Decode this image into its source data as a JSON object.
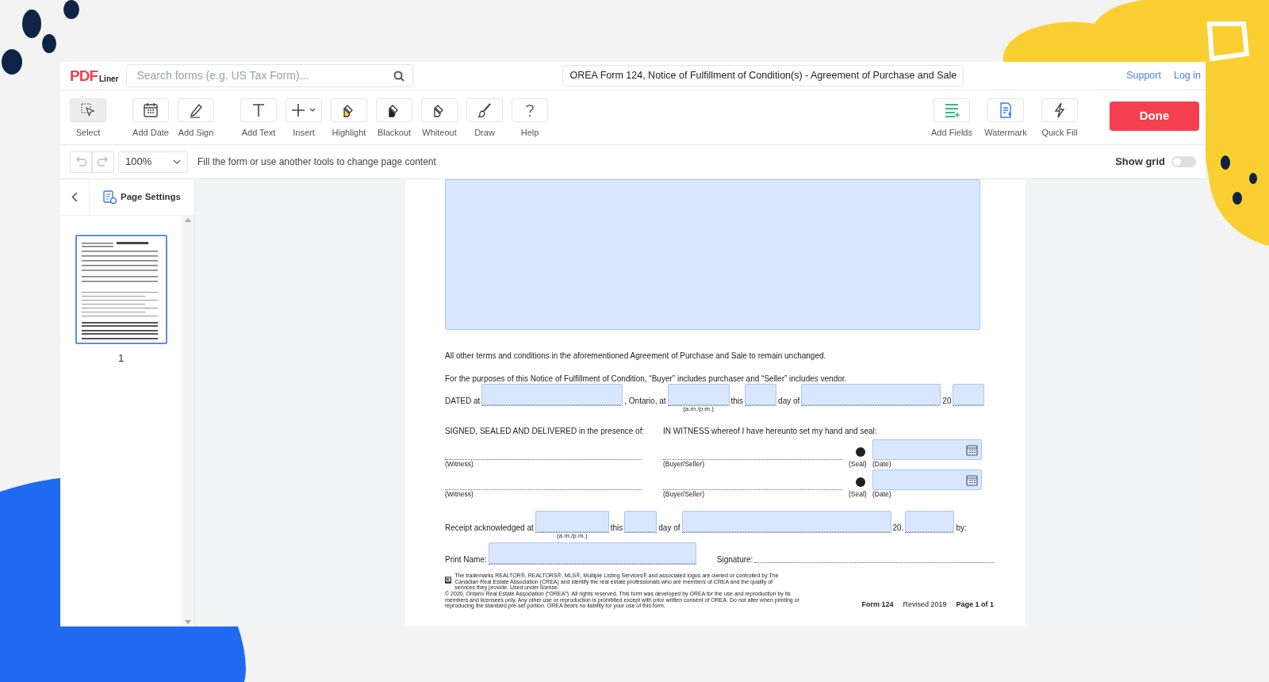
{
  "logo": {
    "mark": "PDF",
    "word": "Liner"
  },
  "search": {
    "placeholder": "Search forms (e.g. US Tax Form)..."
  },
  "document_title": "OREA Form 124, Notice of Fulfillment of Condition(s) - Agreement of Purchase and Sale",
  "header_links": [
    "Support",
    "Log in"
  ],
  "tool_groups": [
    [
      {
        "label": "Select",
        "selected": true
      }
    ],
    [
      {
        "label": "Add Date",
        "selected": false
      },
      {
        "label": "Add Sign",
        "selected": false
      }
    ],
    [
      {
        "label": "Add Text",
        "selected": false
      },
      {
        "label": "Insert",
        "selected": false
      },
      {
        "label": "Highlight",
        "selected": false
      },
      {
        "label": "Blackout",
        "selected": false
      },
      {
        "label": "Whiteout",
        "selected": false
      },
      {
        "label": "Draw",
        "selected": false
      },
      {
        "label": "Help",
        "selected": false
      }
    ]
  ],
  "right_tools": [
    {
      "label": "Add Fields"
    },
    {
      "label": "Watermark"
    },
    {
      "label": "Quick Fill"
    }
  ],
  "done_button": "Done",
  "history": [
    {
      "kind": "undo",
      "disabled": true
    },
    {
      "kind": "redo",
      "disabled": true
    }
  ],
  "zoom": {
    "value": "100%"
  },
  "hint": "Fill the form or use another tools to change page content",
  "show_grid": {
    "label": "Show grid",
    "on": false
  },
  "sidebar": {
    "title": "Page Settings",
    "pages": [
      {
        "label": "1",
        "selected": true
      }
    ]
  },
  "form": {
    "paragraphs": [
      "All other terms and conditions in the aforementioned Agreement of Purchase and Sale to remain unchanged.",
      "For the purposes of this Notice of Fulfillment of Condition, “Buyer” includes purchaser and “Seller” includes vendor."
    ],
    "dated_row": [
      {
        "kind": "text",
        "text": "DATED at"
      },
      {
        "kind": "field"
      },
      {
        "kind": "text",
        "text": ", Ontario, at"
      },
      {
        "kind": "field",
        "caption": "(a.m./p.m.)"
      },
      {
        "kind": "text",
        "text": "this"
      },
      {
        "kind": "field"
      },
      {
        "kind": "text",
        "text": "day of"
      },
      {
        "kind": "field"
      },
      {
        "kind": "text",
        "text": "20"
      },
      {
        "kind": "field"
      }
    ],
    "signature_headings": [
      "SIGNED, SEALED AND DELIVERED in the presence of:",
      "IN WITNESS whereof I have hereunto set my hand and seal:"
    ],
    "signature_rows": [
      {
        "witness": "(Witness)",
        "party": "(Buyer/Seller)",
        "seal": "(Seal)",
        "date": "(Date)"
      },
      {
        "witness": "(Witness)",
        "party": "(Buyer/Seller)",
        "seal": "(Seal)",
        "date": "(Date)"
      }
    ],
    "receipt_row": [
      {
        "kind": "text",
        "text": "Receipt acknowledged at"
      },
      {
        "kind": "field",
        "caption": "(a.m./p.m.)"
      },
      {
        "kind": "text",
        "text": "this"
      },
      {
        "kind": "field"
      },
      {
        "kind": "text",
        "text": "day of"
      },
      {
        "kind": "field"
      },
      {
        "kind": "text",
        "text": "20."
      },
      {
        "kind": "field"
      },
      {
        "kind": "text",
        "text": "by:"
      }
    ],
    "print_row": [
      {
        "kind": "text",
        "text": "Print Name:"
      },
      {
        "kind": "field"
      },
      {
        "kind": "text",
        "text": "Signature:"
      },
      {
        "kind": "line"
      }
    ],
    "trademark_note": "The trademarks REALTOR®, REALTORS®, MLS®, Multiple Listing Services® and associated logos are owned or controlled by The Canadian Real Estate Association (CREA) and identify the real estate professionals who are members of CREA and the quality of services they provide. Used under license.",
    "copyright_note": "© 2020, Ontario Real Estate Association (“OREA”). All rights reserved. This form was developed by OREA for the use and reproduction by its members and licensees only. Any other use or reproduction is prohibited except with prior written consent of OREA. Do not alter when printing or reproducing the standard pre-set portion. OREA bears no liability for your use of this form.",
    "form_number": "Form 124",
    "revised": "Revised 2019",
    "page_info": "Page 1 of 1"
  }
}
